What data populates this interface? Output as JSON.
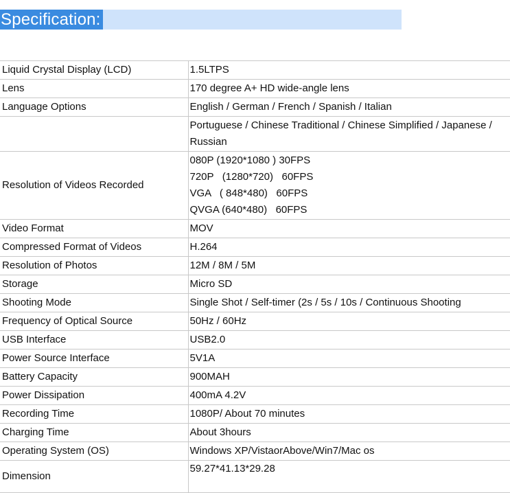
{
  "title": "Specification:",
  "rows": [
    {
      "label": "Liquid Crystal Display (LCD)",
      "lines": [
        "1.5LTPS"
      ]
    },
    {
      "label": "Lens",
      "lines": [
        "170 degree A+ HD wide-angle lens"
      ]
    },
    {
      "label": "Language Options",
      "lines": [
        "English / German / French / Spanish / Italian"
      ]
    },
    {
      "label": "",
      "lines": [
        "Portuguese / Chinese Traditional / Chinese Simplified / Japanese /",
        "Russian"
      ]
    },
    {
      "label": "Resolution of Videos Recorded",
      "lines": [
        "080P (1920*1080 ) 30FPS",
        "720P   (1280*720)   60FPS",
        "VGA   ( 848*480)   60FPS",
        "QVGA (640*480)   60FPS"
      ]
    },
    {
      "label": "Video Format",
      "lines": [
        "MOV"
      ]
    },
    {
      "label": "Compressed Format of Videos",
      "lines": [
        "H.264"
      ]
    },
    {
      "label": "Resolution of Photos",
      "lines": [
        "12M / 8M / 5M"
      ]
    },
    {
      "label": "Storage",
      "lines": [
        "Micro SD"
      ]
    },
    {
      "label": "Shooting Mode",
      "lines": [
        "Single Shot / Self-timer (2s / 5s / 10s / Continuous Shooting"
      ]
    },
    {
      "label": "Frequency of Optical Source",
      "lines": [
        "50Hz / 60Hz"
      ]
    },
    {
      "label": "USB Interface",
      "lines": [
        "USB2.0"
      ]
    },
    {
      "label": "Power Source Interface",
      "lines": [
        "5V1A"
      ]
    },
    {
      "label": "Battery Capacity",
      "lines": [
        "900MAH"
      ]
    },
    {
      "label": "Power Dissipation",
      "lines": [
        "400mA 4.2V"
      ]
    },
    {
      "label": "Recording Time",
      "lines": [
        "1080P/ About 70 minutes"
      ]
    },
    {
      "label": "Charging Time",
      "lines": [
        "About 3hours"
      ]
    },
    {
      "label": "Operating System (OS)",
      "lines": [
        "Windows XP/VistaorAbove/Win7/Mac os"
      ]
    },
    {
      "label": "Dimension",
      "lines": [
        "59.27*41.13*29.28"
      ]
    }
  ]
}
